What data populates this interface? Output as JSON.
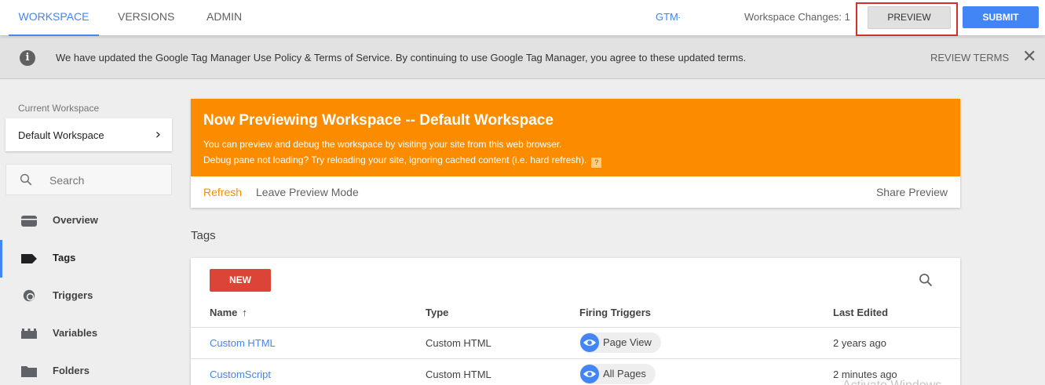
{
  "topbar": {
    "tabs": [
      {
        "label": "WORKSPACE",
        "active": true
      },
      {
        "label": "VERSIONS",
        "active": false
      },
      {
        "label": "ADMIN",
        "active": false
      }
    ],
    "container_id": "GTM-",
    "workspace_changes": "Workspace Changes: 1",
    "preview_label": "PREVIEW",
    "submit_label": "SUBMIT"
  },
  "notice": {
    "text": "We have updated the Google Tag Manager Use Policy & Terms of Service. By continuing to use Google Tag Manager, you agree to these updated terms.",
    "review_label": "REVIEW TERMS",
    "icon": "info-icon"
  },
  "sidebar": {
    "current_workspace_label": "Current Workspace",
    "workspace_name": "Default Workspace",
    "search_placeholder": "Search",
    "items": [
      {
        "label": "Overview",
        "icon": "overview-icon",
        "active": false
      },
      {
        "label": "Tags",
        "icon": "tag-icon",
        "active": true
      },
      {
        "label": "Triggers",
        "icon": "trigger-icon",
        "active": false
      },
      {
        "label": "Variables",
        "icon": "variables-icon",
        "active": false
      },
      {
        "label": "Folders",
        "icon": "folder-icon",
        "active": false
      }
    ]
  },
  "preview_banner": {
    "title": "Now Previewing Workspace -- Default Workspace",
    "line1": "You can preview and debug the workspace by visiting your site from this web browser.",
    "line2": "Debug pane not loading? Try reloading your site, ignoring cached content (i.e. hard refresh).",
    "help_glyph": "?",
    "refresh_label": "Refresh",
    "leave_label": "Leave Preview Mode",
    "share_label": "Share Preview"
  },
  "tags_section": {
    "heading": "Tags",
    "new_label": "NEW",
    "columns": {
      "name": "Name",
      "sort_arrow": "↑",
      "type": "Type",
      "triggers": "Firing Triggers",
      "edited": "Last Edited"
    },
    "rows": [
      {
        "name": "Custom HTML",
        "type": "Custom HTML",
        "trigger": "Page View",
        "edited": "2 years ago"
      },
      {
        "name": "CustomScript",
        "type": "Custom HTML",
        "trigger": "All Pages",
        "edited": "2 minutes ago"
      }
    ]
  },
  "watermark": "Activate Windows",
  "colors": {
    "accent": "#4285f4",
    "preview_orange": "#fb8c00",
    "new_button": "#db4437",
    "highlight_border": "#d32f2f"
  }
}
